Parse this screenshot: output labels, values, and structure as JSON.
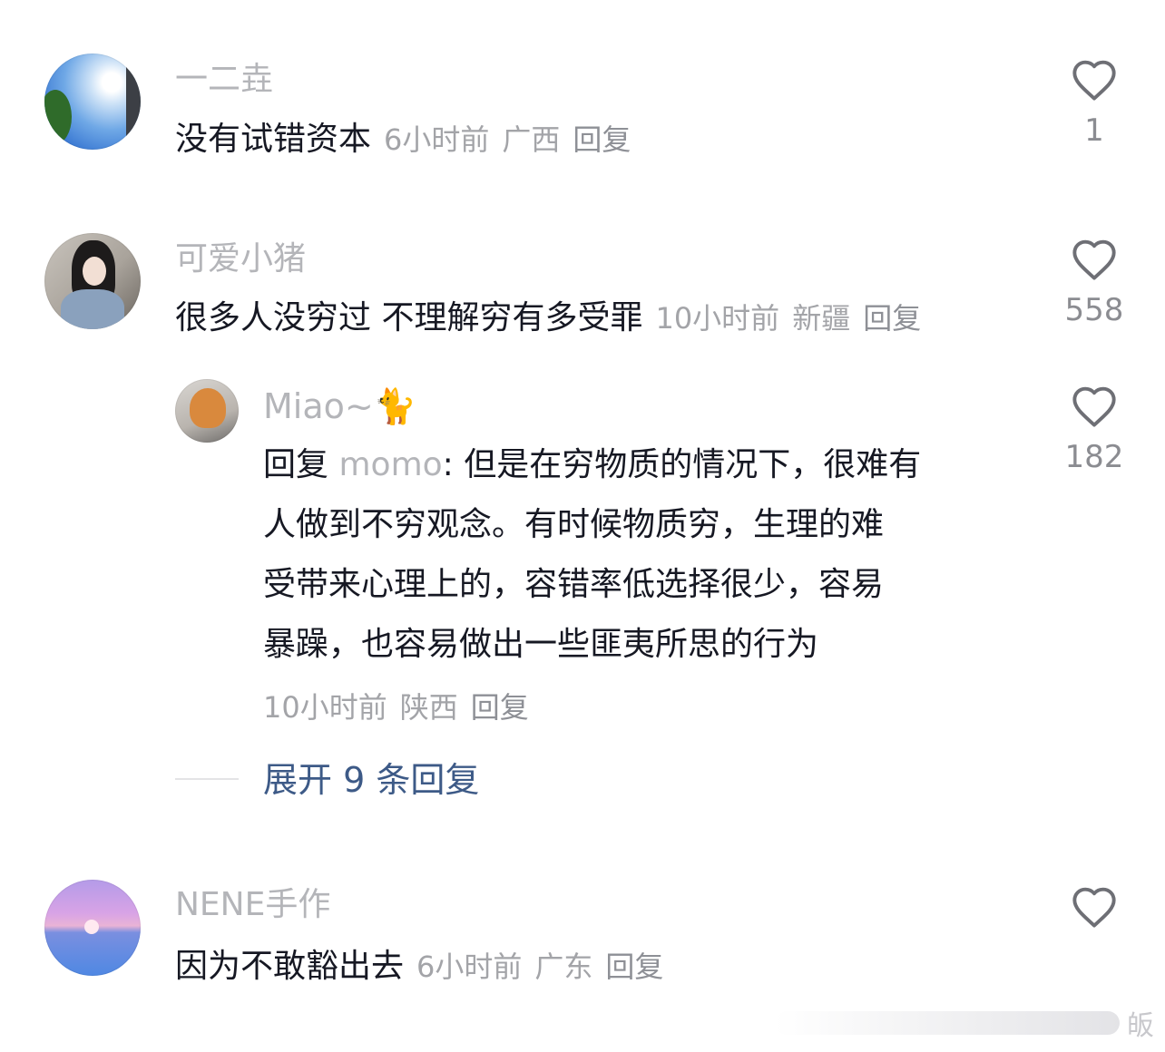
{
  "comments": [
    {
      "username": "一二垚",
      "text": "没有试错资本",
      "time": "6小时前",
      "location": "广西",
      "reply_label": "回复",
      "likes": "1",
      "avatar_theme": "sky"
    },
    {
      "username": "可爱小猪",
      "text": "很多人没穷过 不理解穷有多受罪",
      "time": "10小时前",
      "location": "新疆",
      "reply_label": "回复",
      "likes": "558",
      "avatar_theme": "girl"
    },
    {
      "username": "NENE手作",
      "text": "因为不敢豁出去",
      "time": "6小时前",
      "location": "广东",
      "reply_label": "回复",
      "likes": "",
      "avatar_theme": "sunset-sea"
    }
  ],
  "sub_reply": {
    "username": "Miao~🐈",
    "prefix": "回复",
    "mention": "momo",
    "lines": [
      ": 但是在穷物质的情况下，很难有",
      "人做到不穷观念。有时候物质穷，生理的难",
      "受带来心理上的，容错率低选择很少，容易",
      "暴躁，也容易做出一些匪夷所思的行为"
    ],
    "time": "10小时前",
    "location": "陕西",
    "reply_label": "回复",
    "likes": "182",
    "avatar_theme": "cat"
  },
  "expand_replies": "展开 9 条回复",
  "icons": {
    "like": "heart-outline-icon"
  },
  "colors": {
    "primary_text": "#161823",
    "secondary_text": "#b4b5b9",
    "meta_text": "#a3a4a8",
    "link": "#3d5a87"
  },
  "watermark": "皈"
}
